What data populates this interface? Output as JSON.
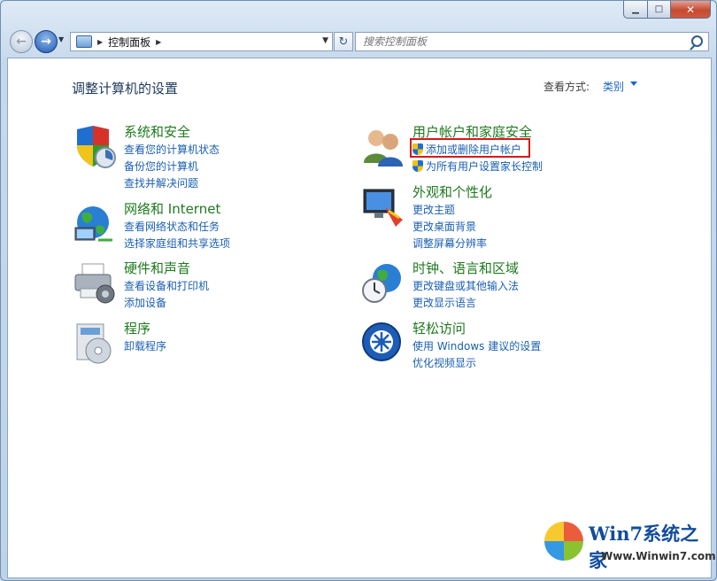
{
  "window": {
    "controls": {
      "min_glyph": "▁",
      "max_glyph": "□",
      "close_glyph": "✕"
    }
  },
  "nav": {
    "back_glyph": "←",
    "forward_glyph": "→",
    "breadcrumb": "控制面板",
    "separator_glyph": "▶",
    "refresh_glyph": "↻",
    "search_placeholder": "搜索控制面板"
  },
  "main": {
    "heading": "调整计算机的设置",
    "view_by_label": "查看方式:",
    "view_by_value": "类别",
    "categories": [
      {
        "title": "系统和安全",
        "icon": "shield-icon",
        "links": [
          "查看您的计算机状态",
          "备份您的计算机",
          "查找并解决问题"
        ]
      },
      {
        "title": "网络和 Internet",
        "icon": "network-globe-icon",
        "links": [
          "查看网络状态和任务",
          "选择家庭组和共享选项"
        ]
      },
      {
        "title": "硬件和声音",
        "icon": "printer-icon",
        "links": [
          "查看设备和打印机",
          "添加设备"
        ]
      },
      {
        "title": "程序",
        "icon": "program-disc-icon",
        "links": [
          "卸载程序"
        ]
      },
      {
        "title": "用户帐户和家庭安全",
        "icon": "users-icon",
        "links": [
          "添加或删除用户帐户",
          "为所有用户设置家长控制"
        ]
      },
      {
        "title": "外观和个性化",
        "icon": "monitor-paint-icon",
        "links": [
          "更改主题",
          "更改桌面背景",
          "调整屏幕分辨率"
        ]
      },
      {
        "title": "时钟、语言和区域",
        "icon": "clock-globe-icon",
        "links": [
          "更改键盘或其他输入法",
          "更改显示语言"
        ]
      },
      {
        "title": "轻松访问",
        "icon": "ease-of-access-icon",
        "links": [
          "使用 Windows 建议的设置",
          "优化视频显示"
        ]
      }
    ]
  },
  "watermark": {
    "title": "Win7系统之家",
    "url": "Www.Winwin7.com"
  }
}
